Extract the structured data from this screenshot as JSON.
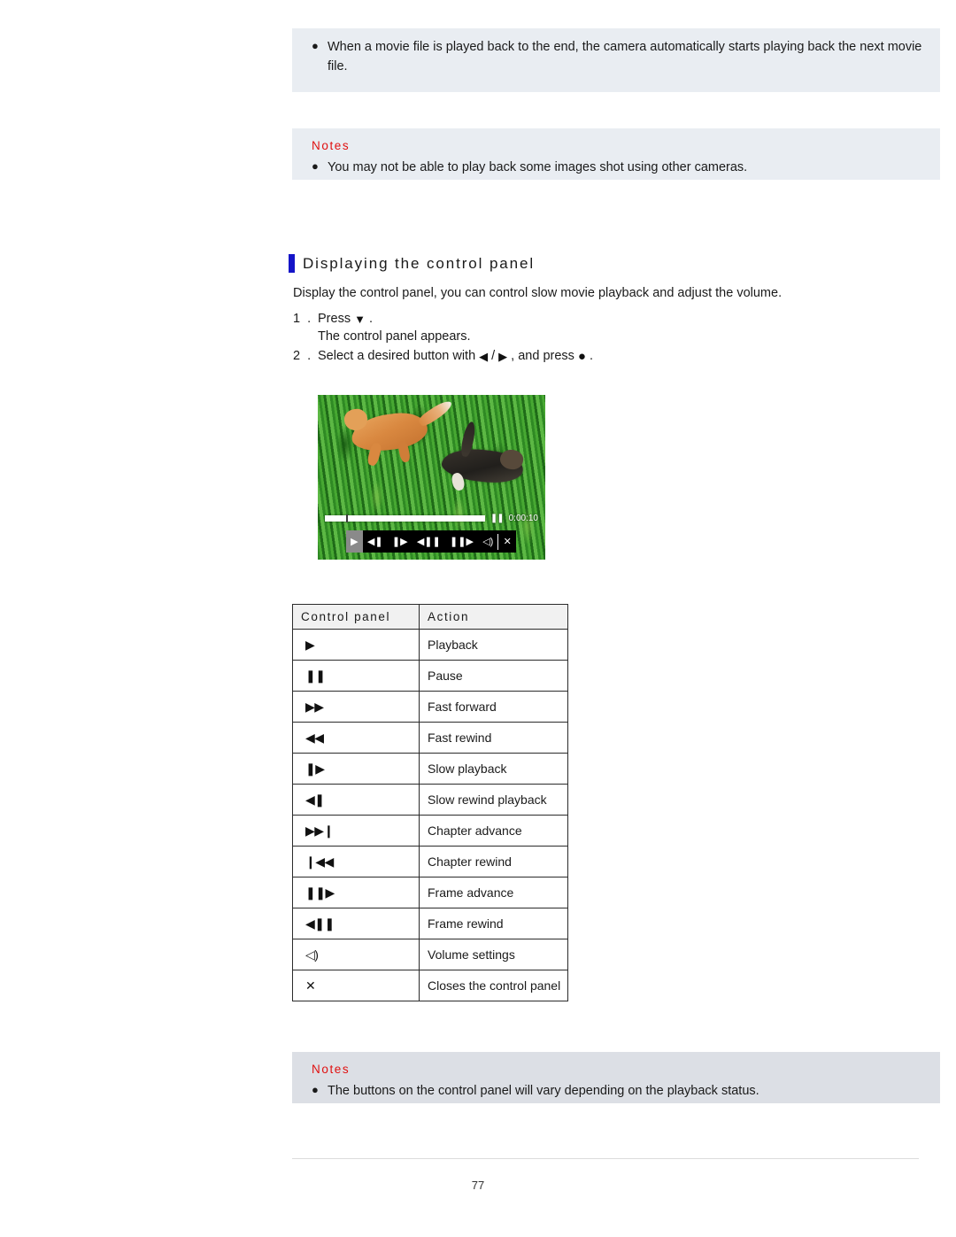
{
  "top_note": {
    "bullet_glyph": "●",
    "text": "When a movie file is played back to the end, the camera automatically starts playing back the next movie file."
  },
  "notes_top": {
    "title": "Notes",
    "bullet_glyph": "●",
    "text": "You may not be able to play back some images shot using other cameras."
  },
  "heading": {
    "title": "Displaying the control panel",
    "bar_color": "#1414c8"
  },
  "intro": "Display the control panel, you can control slow movie playback and adjust the volume.",
  "steps": [
    {
      "number": "1 .",
      "text_before": "Press",
      "glyph": "▼",
      "glyph_name": "down-triangle-icon",
      "text_after": "."
    },
    {
      "number": "2 .",
      "text_before": "Select a desired button with",
      "glyph_left": "◀",
      "glyph_sep": "/",
      "glyph_right": "▶",
      "text_mid": ", and press",
      "glyph_dot": "●",
      "text_after": "."
    }
  ],
  "step1_sub": "The control panel appears.",
  "screen": {
    "time": "0:00:10",
    "pause_glyph": "❚❚",
    "buttons": [
      {
        "name": "playback",
        "glyph": "▶",
        "selected": true
      },
      {
        "name": "slow-rewind-playback",
        "glyph": "◀❚",
        "selected": false
      },
      {
        "name": "slow-playback",
        "glyph": "❚▶",
        "selected": false
      },
      {
        "name": "frame-rewind",
        "glyph": "◀❚❚",
        "selected": false
      },
      {
        "name": "frame-advance",
        "glyph": "❚❚▶",
        "selected": false
      },
      {
        "name": "volume-settings",
        "glyph": "◁)",
        "selected": false
      },
      {
        "name": "close-control-panel",
        "glyph": "✕",
        "selected": false
      }
    ]
  },
  "table": {
    "headers": [
      "Control panel",
      "Action"
    ],
    "rows": [
      {
        "icon": "▶",
        "icon_name": "playback-icon",
        "action": "Playback"
      },
      {
        "icon": "❚❚",
        "icon_name": "pause-icon",
        "action": "Pause"
      },
      {
        "icon": "▶▶",
        "icon_name": "fast-forward-icon",
        "action": "Fast forward"
      },
      {
        "icon": "◀◀",
        "icon_name": "fast-rewind-icon",
        "action": "Fast rewind"
      },
      {
        "icon": "❚▶",
        "icon_name": "slow-playback-icon",
        "action": "Slow playback"
      },
      {
        "icon": "◀❚",
        "icon_name": "slow-rewind-playback-icon",
        "action": "Slow rewind playback"
      },
      {
        "icon": "▶▶❙",
        "icon_name": "chapter-advance-icon",
        "action": "Chapter advance"
      },
      {
        "icon": "❙◀◀",
        "icon_name": "chapter-rewind-icon",
        "action": "Chapter rewind"
      },
      {
        "icon": "❚❚▶",
        "icon_name": "frame-advance-icon",
        "action": "Frame advance"
      },
      {
        "icon": "◀❚❚",
        "icon_name": "frame-rewind-icon",
        "action": "Frame rewind"
      },
      {
        "icon": "◁)",
        "icon_name": "volume-settings-icon",
        "action": "Volume settings"
      },
      {
        "icon": "✕",
        "icon_name": "close-icon",
        "action": "Closes the control panel"
      }
    ]
  },
  "notes_bottom": {
    "title": "Notes",
    "bullet_glyph": "●",
    "text": "The buttons on the control panel will vary depending on the playback status."
  },
  "footer": {
    "page_number": "77"
  }
}
